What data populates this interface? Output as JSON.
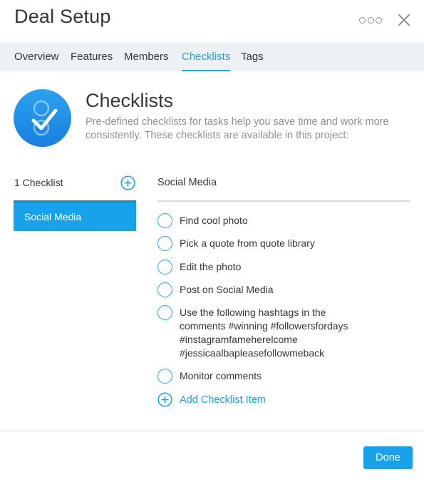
{
  "dialog": {
    "title": "Deal Setup"
  },
  "tabs": [
    {
      "label": "Overview"
    },
    {
      "label": "Features"
    },
    {
      "label": "Members"
    },
    {
      "label": "Checklists",
      "active": true
    },
    {
      "label": "Tags"
    }
  ],
  "hero": {
    "title": "Checklists",
    "description": "Pre-defined checklists for tasks help you save time and work more consistently. These checklists are available in this project:",
    "icon": "checklist-badge-icon"
  },
  "sidebar": {
    "count_label": "1 Checklist",
    "items": [
      {
        "label": "Social Media",
        "selected": true
      }
    ]
  },
  "detail": {
    "title": "Social Media",
    "items": [
      {
        "label": "Find cool photo"
      },
      {
        "label": "Pick a quote from quote library"
      },
      {
        "label": "Edit the photo"
      },
      {
        "label": "Post on Social Media"
      },
      {
        "label": "Use the following hashtags in the comments #winning #followersfordays #instagramfameherelcome #jessicaalbapleasefollowmeback"
      },
      {
        "label": "Monitor comments"
      }
    ],
    "add_label": "Add Checklist Item"
  },
  "footer": {
    "done_label": "Done"
  },
  "colors": {
    "accent": "#1aa3e8",
    "tab_bar": "#eef1f3",
    "text": "#33373b",
    "muted": "#8b9196"
  }
}
